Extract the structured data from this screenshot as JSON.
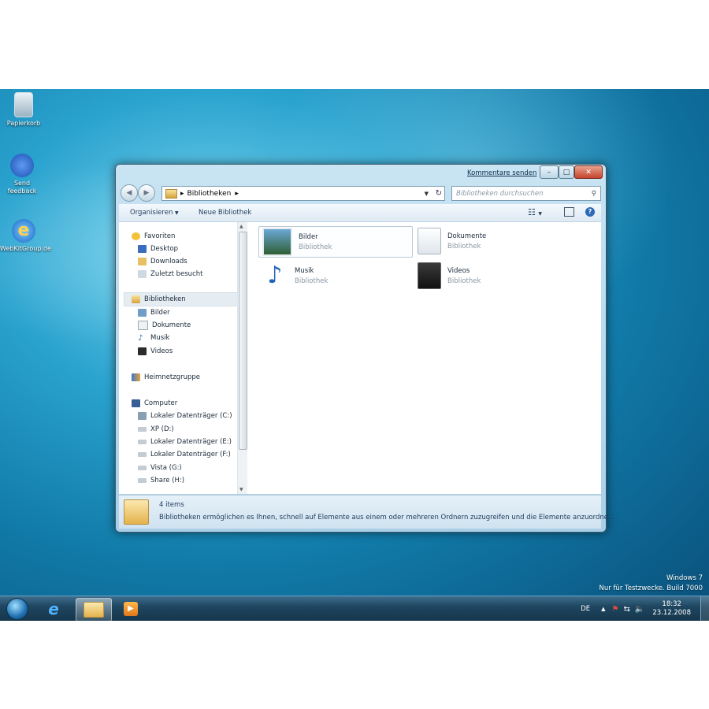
{
  "desktop": {
    "icons": [
      {
        "label": "Papierkorb"
      },
      {
        "label": "Send feedback"
      },
      {
        "label": "WebKitGroup.de"
      }
    ],
    "watermark": {
      "line1": "Windows 7",
      "line2": "Nur für Testzwecke. Build 7000"
    }
  },
  "window": {
    "feedback_link": "Kommentare senden",
    "address": {
      "path": [
        "Bibliotheken"
      ]
    },
    "search": {
      "placeholder": "Bibliotheken durchsuchen"
    },
    "toolbar": {
      "organize": "Organisieren",
      "new_library": "Neue Bibliothek"
    },
    "nav": {
      "favorites": {
        "label": "Favoriten",
        "items": [
          {
            "label": "Desktop"
          },
          {
            "label": "Downloads"
          },
          {
            "label": "Zuletzt besucht"
          }
        ]
      },
      "libraries": {
        "label": "Bibliotheken",
        "items": [
          {
            "label": "Bilder"
          },
          {
            "label": "Dokumente"
          },
          {
            "label": "Musik"
          },
          {
            "label": "Videos"
          }
        ]
      },
      "homegroup": {
        "label": "Heimnetzgruppe"
      },
      "computer": {
        "label": "Computer",
        "items": [
          {
            "label": "Lokaler Datenträger (C:)"
          },
          {
            "label": "XP (D:)"
          },
          {
            "label": "Lokaler Datenträger (E:)"
          },
          {
            "label": "Lokaler Datenträger (F:)"
          },
          {
            "label": "Vista (G:)"
          },
          {
            "label": "Share (H:)"
          }
        ]
      }
    },
    "libraries": [
      {
        "name": "Bilder",
        "type": "Bibliothek"
      },
      {
        "name": "Dokumente",
        "type": "Bibliothek"
      },
      {
        "name": "Musik",
        "type": "Bibliothek"
      },
      {
        "name": "Videos",
        "type": "Bibliothek"
      }
    ],
    "status": {
      "count": "4 items",
      "description": "Bibliotheken ermöglichen es Ihnen, schnell auf Elemente aus einem oder mehreren Ordnern zuzugreifen und die Elemente anzuordne..."
    }
  },
  "taskbar": {
    "language": "DE",
    "time": "18:32",
    "date": "23.12.2008"
  }
}
